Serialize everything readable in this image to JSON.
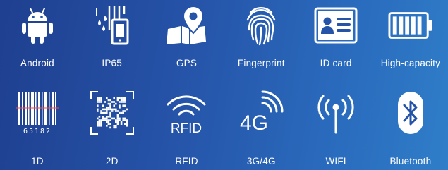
{
  "features": [
    {
      "label": "Android",
      "icon": "android-icon"
    },
    {
      "label": "IP65",
      "icon": "water-resistant-icon"
    },
    {
      "label": "GPS",
      "icon": "map-pin-icon"
    },
    {
      "label": "Fingerprint",
      "icon": "fingerprint-icon"
    },
    {
      "label": "ID card",
      "icon": "id-card-icon"
    },
    {
      "label": "High-capacity",
      "icon": "battery-icon"
    },
    {
      "label": "1D",
      "icon": "barcode-icon",
      "icon_text": "65182"
    },
    {
      "label": "2D",
      "icon": "qr-code-icon"
    },
    {
      "label": "RFID",
      "icon": "rfid-icon",
      "icon_text": "RFID"
    },
    {
      "label": "3G/4G",
      "icon": "cellular-4g-icon",
      "icon_text": "4G"
    },
    {
      "label": "WIFI",
      "icon": "wifi-antenna-icon"
    },
    {
      "label": "Bluetooth",
      "icon": "bluetooth-icon"
    }
  ],
  "colors": {
    "background_start": "#1f3f8f",
    "background_end": "#2f7ec9",
    "foreground": "#ffffff"
  }
}
